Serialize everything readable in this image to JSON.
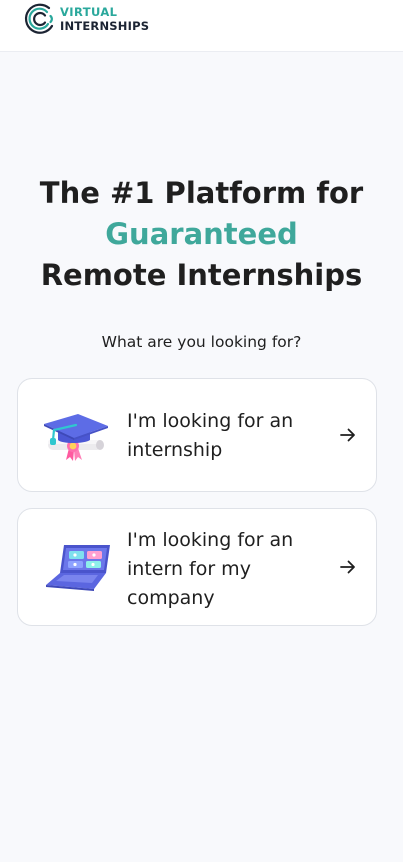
{
  "header": {
    "logo_line1": "VIRTUAL",
    "logo_line2": "INTERNSHIPS"
  },
  "hero": {
    "line1": "The #1 Platform for",
    "line2": "Guaranteed",
    "line3": "Remote Internships"
  },
  "question": "What are you looking for?",
  "options": [
    {
      "label": "I'm looking for an internship",
      "icon": "graduation-cap-icon",
      "arrow": "arrow-right-icon"
    },
    {
      "label": "I'm looking for an intern for my company",
      "icon": "laptop-icon",
      "arrow": "arrow-right-icon"
    }
  ],
  "colors": {
    "brand_teal": "#3fa89b",
    "text": "#1f1f1f",
    "background": "#f8f9fc",
    "card_border": "#dfe2e8"
  }
}
